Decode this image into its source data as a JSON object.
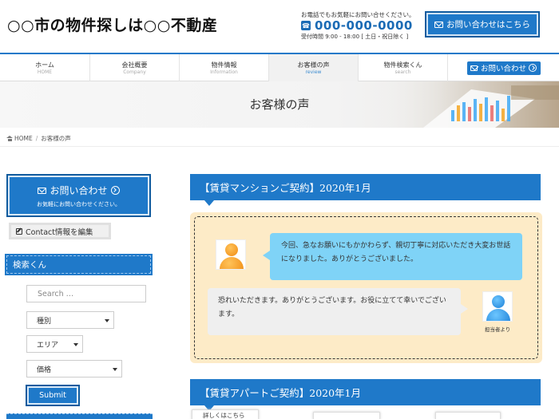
{
  "header": {
    "site_title": "○○市の物件探しは○○不動産",
    "phone_note": "お電話でもお気軽にお問い合せください。",
    "phone_number": "000-000-0000",
    "hours": "受付時間 9:00 - 18:00 [ 土日・祝日除く ]",
    "contact_button": "お問い合わせはこちら"
  },
  "nav": {
    "items": [
      {
        "label": "ホーム",
        "sub": "HOME"
      },
      {
        "label": "会社概要",
        "sub": "Company"
      },
      {
        "label": "物件情報",
        "sub": "Information"
      },
      {
        "label": "お客様の声",
        "sub": "review"
      },
      {
        "label": "物件検索くん",
        "sub": "search"
      }
    ],
    "contact_button": "お問い合わせ"
  },
  "hero": {
    "title": "お客様の声"
  },
  "breadcrumb": {
    "home": "HOME",
    "separator": "/",
    "current": "お客様の声"
  },
  "sidebar": {
    "contact_title": "お問い合わせ",
    "contact_sub": "お気軽にお問い合わせください。",
    "edit_button": "Contact情報を編集",
    "search_widget_title": "検索くん",
    "search_placeholder": "Search …",
    "select_type": "種別",
    "select_area": "エリア",
    "select_price": "価格",
    "submit_button": "Submit"
  },
  "main": {
    "review1_heading": "【賃貸マンションご契約】2020年1月",
    "review1_customer_text": "今回、急なお願いにもかかわらず、親切丁寧に対応いただき大変お世話になりました。ありがとうございました。",
    "review1_staff_text": "恐れいただきます。ありがとうございます。お役に立てて幸いでございます。",
    "staff_caption": "担当者より",
    "review2_heading": "【賃貸アパートご契約】2020年1月",
    "detail_tab": "詳しくはこちら"
  },
  "colors": {
    "accent": "#1f79c9",
    "accent_dark": "#115b9e",
    "review_bg": "#fdebc7",
    "customer_bubble": "#7fd3f7"
  }
}
